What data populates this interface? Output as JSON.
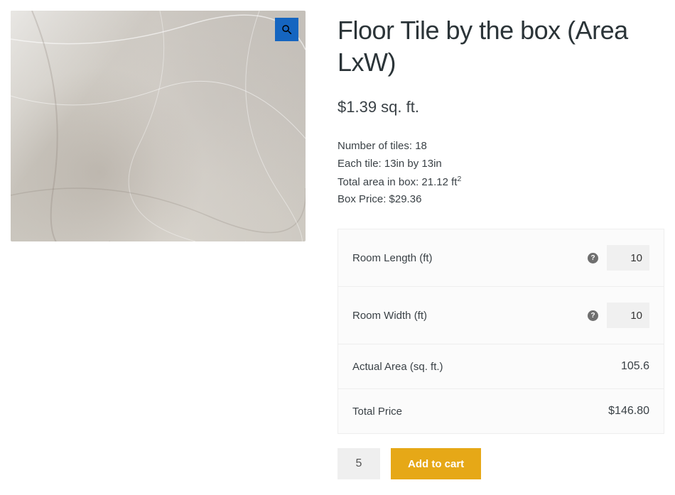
{
  "product": {
    "title": "Floor Tile by the box (Area LxW)",
    "price_text": "$1.39 sq. ft.",
    "meta": {
      "tiles_label": "Number of tiles:",
      "tiles_value": "18",
      "each_label": "Each tile:",
      "each_value": "13in by 13in",
      "area_label": "Total area in box:",
      "area_value": "21.12 ft",
      "area_sup": "2",
      "boxprice_label": "Box Price:",
      "boxprice_value": "$29.36"
    }
  },
  "form": {
    "room_length": {
      "label": "Room Length (ft)",
      "value": "10"
    },
    "room_width": {
      "label": "Room Width (ft)",
      "value": "10"
    },
    "actual_area": {
      "label": "Actual Area (sq. ft.)",
      "value": "105.6"
    },
    "total_price": {
      "label": "Total Price",
      "value": "$146.80"
    }
  },
  "cart": {
    "qty": "5",
    "button": "Add to cart"
  },
  "icons": {
    "help": "?"
  }
}
